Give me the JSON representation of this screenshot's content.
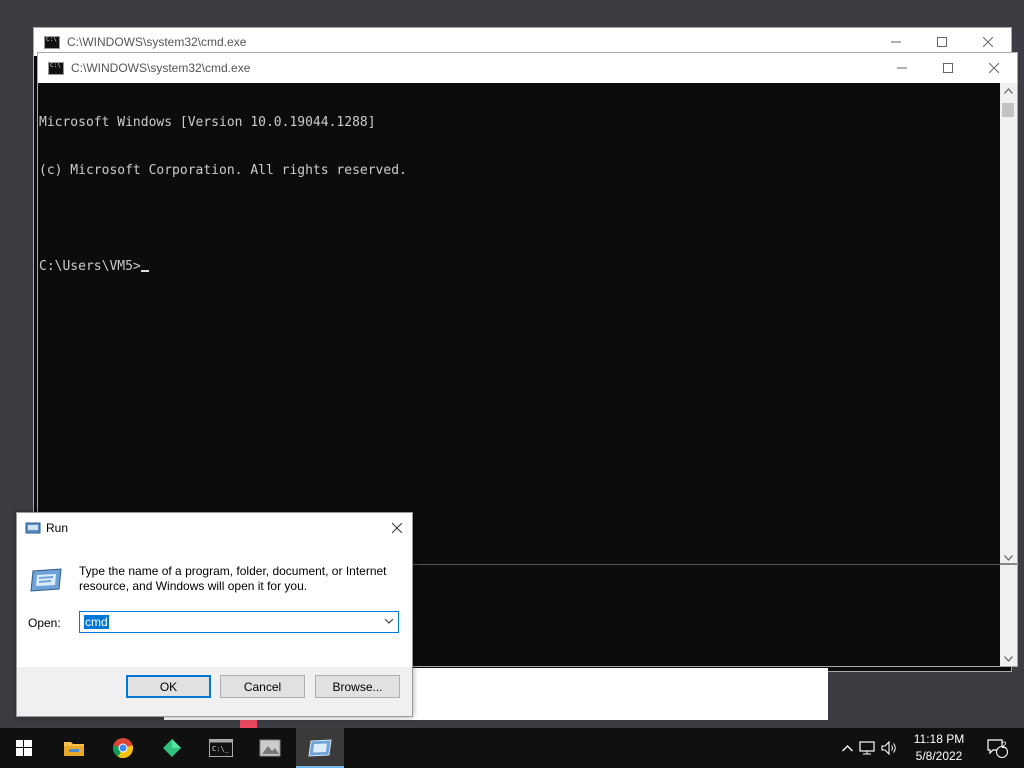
{
  "desktop": {
    "background": "#3b3d42"
  },
  "cmd_back": {
    "title": "C:\\WINDOWS\\system32\\cmd.exe"
  },
  "cmd_front": {
    "title": "C:\\WINDOWS\\system32\\cmd.exe",
    "lines": [
      "Microsoft Windows [Version 10.0.19044.1288]",
      "(c) Microsoft Corporation. All rights reserved.",
      "",
      "C:\\Users\\VM5>"
    ]
  },
  "run_dialog": {
    "title": "Run",
    "description": "Type the name of a program, folder, document, or Internet resource, and Windows will open it for you.",
    "open_label": "Open:",
    "open_value": "cmd",
    "ok_label": "OK",
    "cancel_label": "Cancel",
    "browse_label": "Browse..."
  },
  "taskbar": {
    "items": [
      {
        "name": "start-button",
        "icon": "windows-logo-icon"
      },
      {
        "name": "file-explorer",
        "icon": "folder-icon"
      },
      {
        "name": "chrome",
        "icon": "chrome-icon"
      },
      {
        "name": "green-app",
        "icon": "green-diamond-icon"
      },
      {
        "name": "command-prompt",
        "icon": "cmd-icon"
      },
      {
        "name": "image-viewer",
        "icon": "landscape-icon"
      },
      {
        "name": "run",
        "icon": "run-icon"
      }
    ],
    "time": "11:18 PM",
    "date": "5/8/2022",
    "notification_count": "2"
  },
  "colors": {
    "accent": "#0078d7",
    "console_bg": "#0c0c0c",
    "console_fg": "#cccccc",
    "taskbar_bg": "#101010"
  }
}
